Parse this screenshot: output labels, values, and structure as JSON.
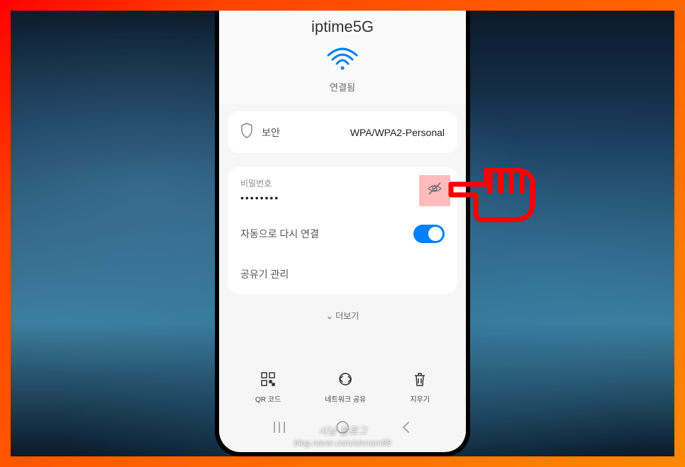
{
  "header": {
    "networkName": "iptime5G"
  },
  "status": {
    "connectedLabel": "연결됨"
  },
  "security": {
    "label": "보안",
    "value": "WPA/WPA2-Personal"
  },
  "password": {
    "label": "비밀번호",
    "masked": "••••••••"
  },
  "autoReconnect": {
    "label": "자동으로 다시 연결",
    "enabled": true
  },
  "routerManage": {
    "label": "공유기 관리"
  },
  "more": {
    "label": "더보기",
    "chevron": "⌄"
  },
  "bottomActions": {
    "qr": "QR 코드",
    "share": "네트워크 공유",
    "delete": "지우기"
  },
  "watermark": {
    "title": "시남 블로그",
    "url": "blog.naver.com/sinnam88"
  }
}
